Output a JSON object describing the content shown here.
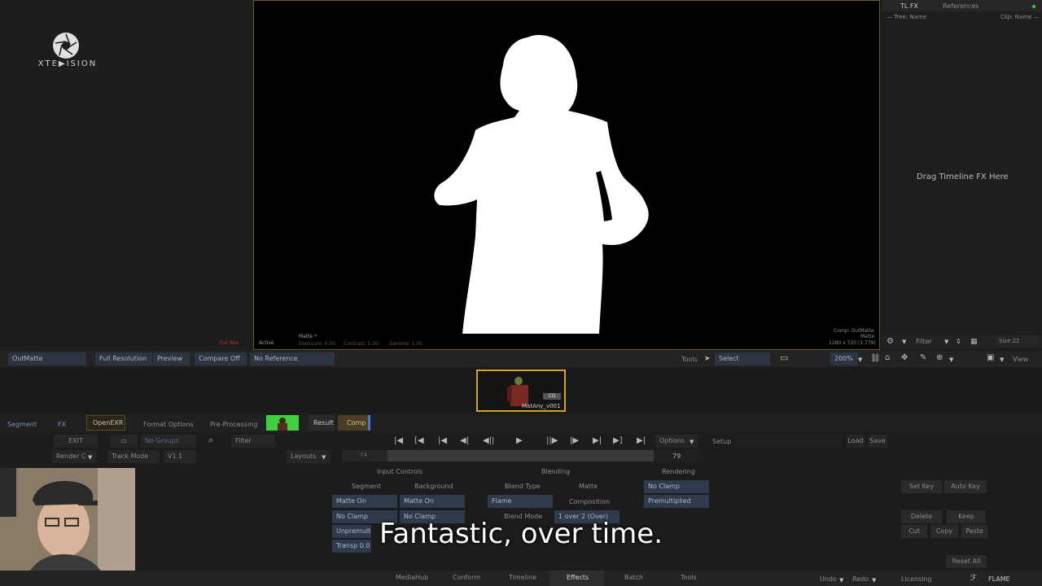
{
  "logo": {
    "text": "XTE▶ISION"
  },
  "right_panel": {
    "tabs": [
      "TL FX",
      "References"
    ],
    "tree_header": "— Tree: Name",
    "clip_header": "Clip: Name —",
    "drag_hint": "Drag Timeline FX Here",
    "filter_label": "Filter",
    "size_label": "Size 22"
  },
  "viewer": {
    "matte_label": "Matte *",
    "status_red": "Full Res",
    "status_active": "Active",
    "exposure": "Exposure: 0.00",
    "contrast": "Contrast: 1.00",
    "gamma": "Gamma: 1.00",
    "comp_info": "Comp: OutMatte",
    "matte_info": "Matte",
    "res_info": "1280 x 720 (1.778)"
  },
  "view_bar": {
    "outmatte": "OutMatte",
    "full_res": "Full Resolution",
    "preview": "Preview",
    "compare": "Compare Off",
    "reference": "No Reference",
    "tools": "Tools",
    "select": "Select",
    "zoom": "200%",
    "view": "View"
  },
  "thumbnail": {
    "tag": "CG",
    "clip_name": "MatAny_v001"
  },
  "node_bar": {
    "segment": "Segment",
    "fx": "FX",
    "openexr": "OpenEXR",
    "format_options": "Format Options",
    "pre_processing": "Pre-Processing",
    "result": "Result",
    "comp": "Comp"
  },
  "controls": {
    "exit": "EXIT",
    "no_groups": "No Groups",
    "filter": "Filter",
    "render": "Render C",
    "track_mode": "Track Mode",
    "version": "V1.1",
    "layouts": "Layouts",
    "frame_start": "74",
    "frame_end": "79",
    "options": "Options",
    "setup": "Setup",
    "load": "Load",
    "save": "Save"
  },
  "params": {
    "input_controls": "Input Controls",
    "blending": "Blending",
    "rendering": "Rendering",
    "segment": "Segment",
    "background": "Background",
    "blend_type": "Blend Type",
    "matte": "Matte",
    "matte_on_1": "Matte On",
    "matte_on_2": "Matte On",
    "flame": "Flame",
    "composition": "Composition",
    "no_clamp_r": "No Clamp",
    "premultiplied": "Premultiplied",
    "no_clamp_1": "No Clamp",
    "no_clamp_2": "No Clamp",
    "blend_mode": "Blend Mode",
    "over": "1 over 2 (Over)",
    "unpremult": "Unpremulti",
    "transp": "Transp 0.0",
    "set_key": "Set Key",
    "auto_key": "Auto Key",
    "delete": "Delete",
    "keep": "Keep",
    "cut": "Cut",
    "copy": "Copy",
    "paste": "Paste",
    "reset_all": "Reset All"
  },
  "subtitle": "Fantastic, over time.",
  "bottom_tabs": [
    "MediaHub",
    "Conform",
    "Timeline",
    "Effects",
    "Batch",
    "Tools"
  ],
  "bottom_right": {
    "undo": "Undo",
    "redo": "Redo",
    "licensing": "Licensing",
    "flame": "FLAME"
  }
}
